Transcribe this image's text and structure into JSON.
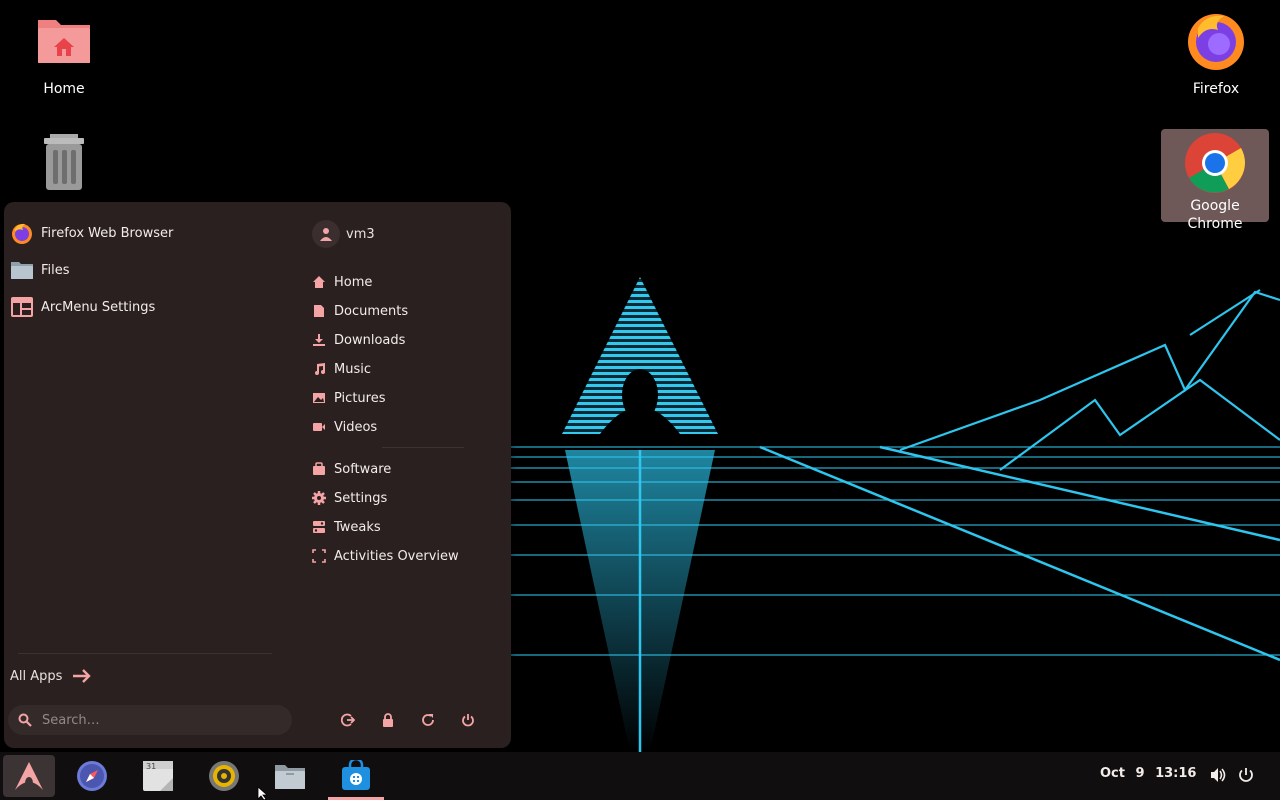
{
  "desktop": {
    "icons": [
      {
        "label": "Home"
      },
      {
        "label": ""
      },
      {
        "label": "Firefox"
      },
      {
        "label": "Google Chrome"
      }
    ]
  },
  "menu": {
    "pinned_apps": [
      {
        "label": "Firefox Web Browser",
        "icon": "firefox-icon"
      },
      {
        "label": "Files",
        "icon": "folder-icon"
      },
      {
        "label": "ArcMenu Settings",
        "icon": "arcmenu-settings-icon"
      }
    ],
    "user": {
      "name": "vm3",
      "icon": "user-avatar-icon"
    },
    "places": [
      {
        "label": "Home",
        "icon": "home-icon"
      },
      {
        "label": "Documents",
        "icon": "document-icon"
      },
      {
        "label": "Downloads",
        "icon": "download-icon"
      },
      {
        "label": "Music",
        "icon": "music-icon"
      },
      {
        "label": "Pictures",
        "icon": "picture-icon"
      },
      {
        "label": "Videos",
        "icon": "video-icon"
      }
    ],
    "system": [
      {
        "label": "Software",
        "icon": "software-icon"
      },
      {
        "label": "Settings",
        "icon": "settings-icon"
      },
      {
        "label": "Tweaks",
        "icon": "tweaks-icon"
      },
      {
        "label": "Activities Overview",
        "icon": "activities-icon"
      }
    ],
    "all_apps_label": "All Apps",
    "search_placeholder": "Search…",
    "power_buttons": [
      "log-out-icon",
      "lock-icon",
      "restart-icon",
      "power-icon"
    ]
  },
  "taskbar": {
    "apps": [
      "arcmenu-icon",
      "web-browser-icon",
      "calendar-icon",
      "music-player-icon",
      "files-icon",
      "software-store-icon"
    ],
    "calendar_day": "31",
    "clock": {
      "date": "Oct 9",
      "time": "13:16"
    },
    "tray": [
      "volume-icon",
      "power-icon"
    ]
  },
  "colors": {
    "accent": "#f4a4a4",
    "menu_bg": "#2a2020",
    "wallpaper_line": "#2ec6ee"
  }
}
